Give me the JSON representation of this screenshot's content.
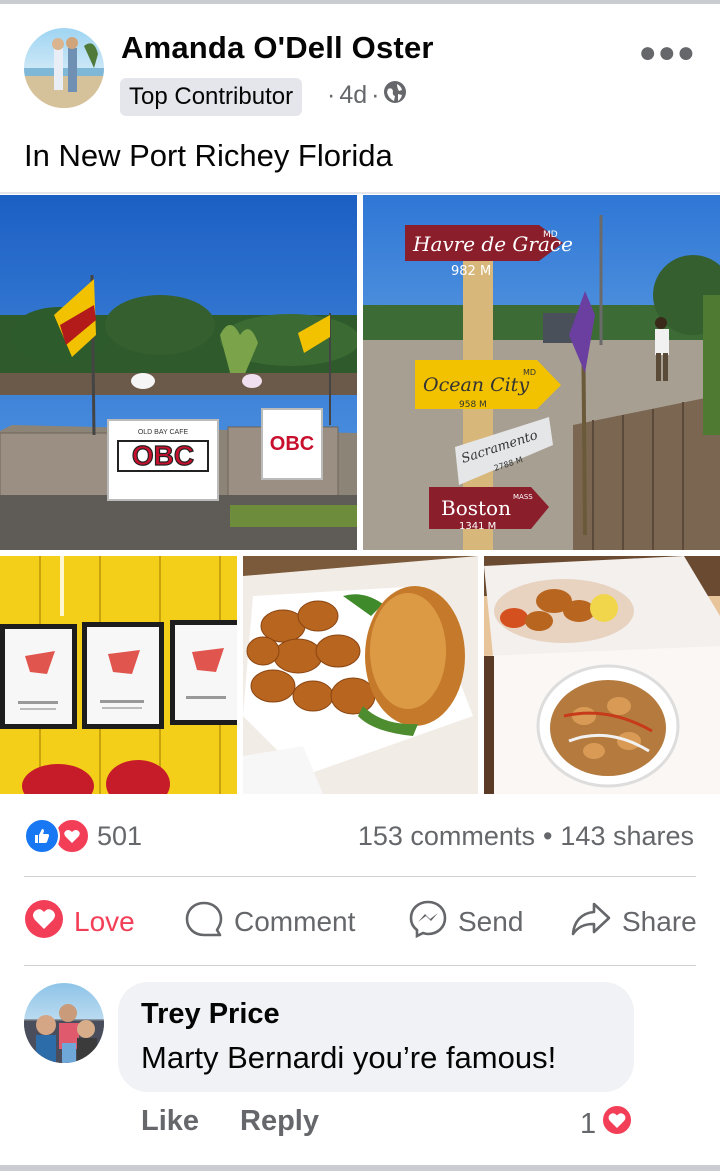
{
  "post": {
    "author": "Amanda O'Dell Oster",
    "badge": "Top Contributor",
    "time": "4d",
    "caption": "In New Port Richey Florida"
  },
  "photos": {
    "sign_banner": "OBC",
    "sign_banner_top": "OLD BAY CAFE",
    "signpost": [
      {
        "place": "Havre de Grace",
        "state": "MD",
        "dist": "982 M"
      },
      {
        "place": "Ocean City",
        "state": "MD",
        "dist": "958 M"
      },
      {
        "place": "Sacramento",
        "state": "",
        "dist": "2788 M"
      },
      {
        "place": "Boston",
        "state": "MASS",
        "dist": "1341 M"
      }
    ]
  },
  "stats": {
    "reactions": "501",
    "comments": "153 comments",
    "shares": "143 shares"
  },
  "actions": {
    "love": "Love",
    "comment": "Comment",
    "send": "Send",
    "share": "Share"
  },
  "comment": {
    "name": "Trey Price",
    "text": "Marty Bernardi you’re famous!",
    "like": "Like",
    "reply": "Reply",
    "reaction_count": "1"
  },
  "colors": {
    "love": "#f33e58",
    "like": "#1877f2",
    "muted": "#65676b"
  },
  "icons": [
    "more-icon",
    "globe-icon",
    "like-reaction-icon",
    "love-reaction-icon",
    "love-heart-icon",
    "comment-icon",
    "messenger-icon",
    "share-arrow-icon"
  ]
}
